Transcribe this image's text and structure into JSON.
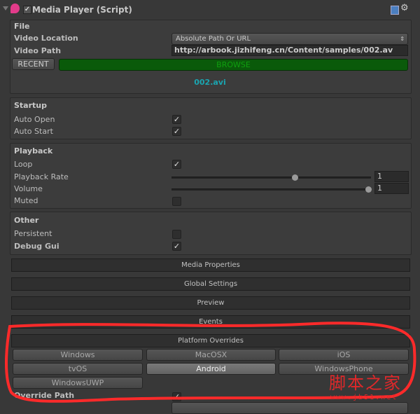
{
  "header": {
    "title": "Media Player (Script)",
    "enabled": true,
    "icons": [
      "media-player-icon",
      "help-book-icon",
      "gear-icon"
    ]
  },
  "file": {
    "heading": "File",
    "video_location_label": "Video Location",
    "video_location_value": "Absolute Path Or URL",
    "video_path_label": "Video Path",
    "video_path_value": "http://arbook.jizhifeng.cn/Content/samples/002.av",
    "recent": "RECENT",
    "browse": "BROWSE",
    "filename": "002.avi"
  },
  "startup": {
    "heading": "Startup",
    "auto_open": "Auto Open",
    "auto_open_checked": true,
    "auto_start": "Auto Start",
    "auto_start_checked": true
  },
  "playback": {
    "heading": "Playback",
    "loop": "Loop",
    "loop_checked": true,
    "rate_label": "Playback Rate",
    "rate_value": "1",
    "rate_fraction": 0.5,
    "volume_label": "Volume",
    "volume_value": "1",
    "volume_fraction": 1.0,
    "muted": "Muted",
    "muted_checked": false
  },
  "other": {
    "heading": "Other",
    "persistent": "Persistent",
    "persistent_checked": false,
    "debug_gui": "Debug Gui",
    "debug_gui_checked": true
  },
  "sections": [
    "Media Properties",
    "Global Settings",
    "Preview",
    "Events",
    "Platform Overrides"
  ],
  "platforms": [
    "Windows",
    "MacOSX",
    "iOS",
    "tvOS",
    "Android",
    "WindowsPhone",
    "WindowsUWP"
  ],
  "selected_platform": "Android",
  "override_path": {
    "label": "Override Path",
    "checked": true
  },
  "colors": {
    "browse_bg": "#0a5a0a",
    "browse_text": "#0fa00f",
    "filename": "#1aa5b0",
    "annotation": "#ff2a2a"
  },
  "watermark": {
    "text": "脚本之家",
    "url": "www.jb51.net"
  }
}
